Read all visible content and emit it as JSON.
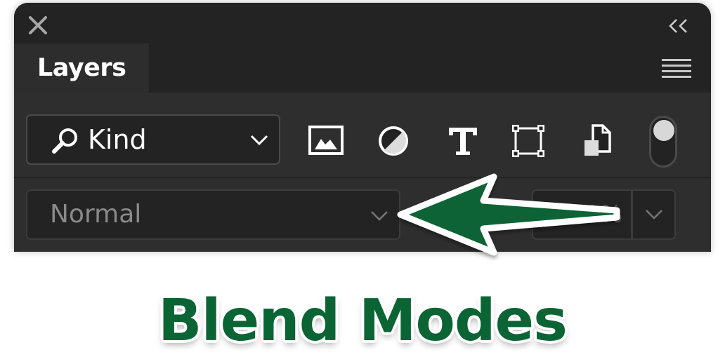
{
  "panel": {
    "close_icon": "close-icon",
    "collapse_icon": "double-chevron-left-icon",
    "tab_label": "Layers",
    "menu_icon": "panel-menu-icon"
  },
  "filter": {
    "kind_label": "Kind",
    "kind_icon": "search-icon",
    "icons": [
      "pixel-layer-filter-icon",
      "adjustment-layer-filter-icon",
      "type-layer-filter-icon",
      "shape-layer-filter-icon",
      "smart-object-filter-icon"
    ],
    "toggle_on": true
  },
  "blend": {
    "mode_label": "Normal",
    "opacity_value": "100%"
  },
  "annotation": {
    "caption": "Blend Modes",
    "arrow_color": "#0b6434",
    "caption_color": "#0b6434"
  }
}
